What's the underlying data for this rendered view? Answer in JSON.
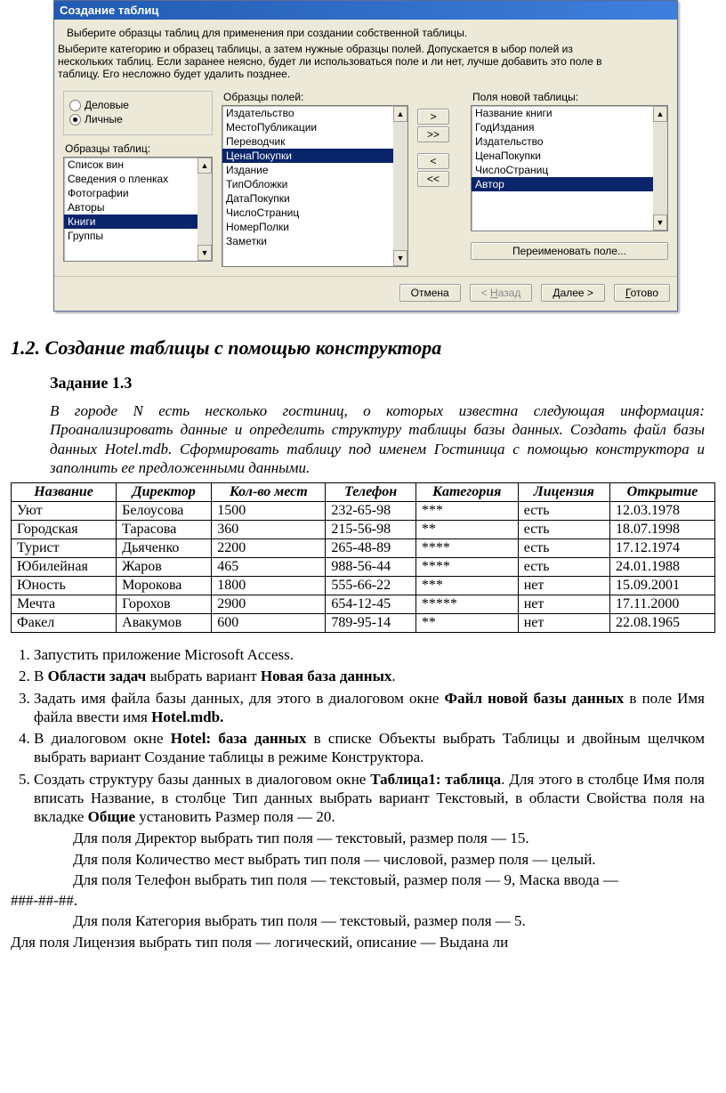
{
  "dialog": {
    "title": "Создание таблиц",
    "intro": "Выберите образцы таблиц для применения при создании собственной таблицы.",
    "desc": "Выберите категорию и образец таблицы, а затем нужные образцы полей. Допускается в ыбор полей из нескольких таблиц. Если заранее неясно, будет ли использоваться поле и ли нет, лучше добавить это поле в таблицу. Его несложно будет удалить позднее.",
    "radios": {
      "business": "Деловые",
      "personal": "Личные",
      "selected": "personal"
    },
    "labels": {
      "samples": "Образцы таблиц:",
      "fields": "Образцы полей:",
      "newfields": "Поля новой таблицы:"
    },
    "samples": [
      "Список вин",
      "Сведения о пленках",
      "Фотографии",
      "Авторы",
      "Книги",
      "Группы"
    ],
    "samples_selected": "Книги",
    "fields": [
      "Издательство",
      "МестоПубликации",
      "Переводчик",
      "ЦенаПокупки",
      "Издание",
      "ТипОбложки",
      "ДатаПокупки",
      "ЧислоСтраниц",
      "НомерПолки",
      "Заметки"
    ],
    "fields_selected": "ЦенаПокупки",
    "newfields": [
      "Название книги",
      "ГодИздания",
      "Издательство",
      "ЦенаПокупки",
      "ЧислоСтраниц",
      "Автор"
    ],
    "newfields_selected": "Автор",
    "move": {
      "add": ">",
      "addall": ">>",
      "remove": "<",
      "removeall": "<<"
    },
    "rename": "Переименовать поле...",
    "wizard": {
      "cancel": "Отмена",
      "back_lt": "<",
      "back_u": "Н",
      "back_rest": "азад",
      "next_u": "Д",
      "next_rest": "алее >",
      "finish_u": "Г",
      "finish_rest": "отово"
    }
  },
  "section": {
    "heading": "1.2. Создание таблицы с помощью конструктора",
    "task_title": "Задание 1.3",
    "task_text": "В городе N есть несколько гостиниц, о которых известна следующая информация: Проанализировать данные и определить структуру таблицы базы данных. Создать файл базы данных Hotel.mdb. Сформировать таблицу под именем Гостиница с помощью конструктора и заполнить ее предложенными данными."
  },
  "table": {
    "headers": [
      "Название",
      "Директор",
      "Кол-во мест",
      "Телефон",
      "Категория",
      "Лицензия",
      "Открытие"
    ],
    "rows": [
      [
        "Уют",
        "Белоусова",
        "1500",
        "232-65-98",
        "***",
        "есть",
        "12.03.1978"
      ],
      [
        "Городская",
        "Тарасова",
        "360",
        "215-56-98",
        "**",
        "есть",
        "18.07.1998"
      ],
      [
        "Турист",
        "Дьяченко",
        "2200",
        "265-48-89",
        "****",
        "есть",
        "17.12.1974"
      ],
      [
        "Юбилейная",
        "Жаров",
        "465",
        "988-56-44",
        "****",
        "есть",
        "24.01.1988"
      ],
      [
        "Юность",
        "Морокова",
        "1800",
        "555-66-22",
        "***",
        "нет",
        "15.09.2001"
      ],
      [
        "Мечта",
        "Горохов",
        "2900",
        "654-12-45",
        "*****",
        "нет",
        "17.11.2000"
      ],
      [
        "Факел",
        "Авакумов",
        "600",
        "789-95-14",
        "**",
        "нет",
        "22.08.1965"
      ]
    ]
  },
  "steps": {
    "s1": "Запустить приложение Microsoft Access.",
    "s2_a": "В ",
    "s2_b": "Области задач",
    "s2_c": " выбрать вариант ",
    "s2_d": "Новая база данных",
    "s2_e": ".",
    "s3_a": "Задать имя файла базы данных, для этого в диалоговом окне ",
    "s3_b": "Файл новой базы данных",
    "s3_c": " в поле Имя файла ввести имя ",
    "s3_d": "Hotel.mdb.",
    "s4_a": "В диалоговом окне ",
    "s4_b": "Hotel: база данных",
    "s4_c": " в списке Объекты выбрать Таблицы и двойным щелчком выбрать вариант Создание таблицы в режиме Конструктора.",
    "s5_a": "Создать структуру базы данных в диалоговом окне ",
    "s5_b": "Таблица1: таблица",
    "s5_c": ". Для этого в столбце Имя поля вписать Название, в столбце Тип данных выбрать вариант Текстовый, в области Свойства поля на вкладке ",
    "s5_d": "Общие",
    "s5_e": " установить Размер поля — 20."
  },
  "fields_detail": {
    "f1": "Для поля Директор выбрать тип поля — текстовый, размер поля — 15.",
    "f2": "Для поля Количество мест выбрать тип поля — числовой, размер поля — целый.",
    "f3": "Для поля Телефон выбрать тип поля — текстовый, размер поля — 9, Маска ввода —"
  },
  "tail": {
    "mask": "###-##-##.",
    "t1": "Для поля Категория выбрать тип поля — текстовый, размер поля — 5.",
    "t2": "Для поля Лицензия выбрать тип поля — логический, описание — Выдана ли"
  }
}
